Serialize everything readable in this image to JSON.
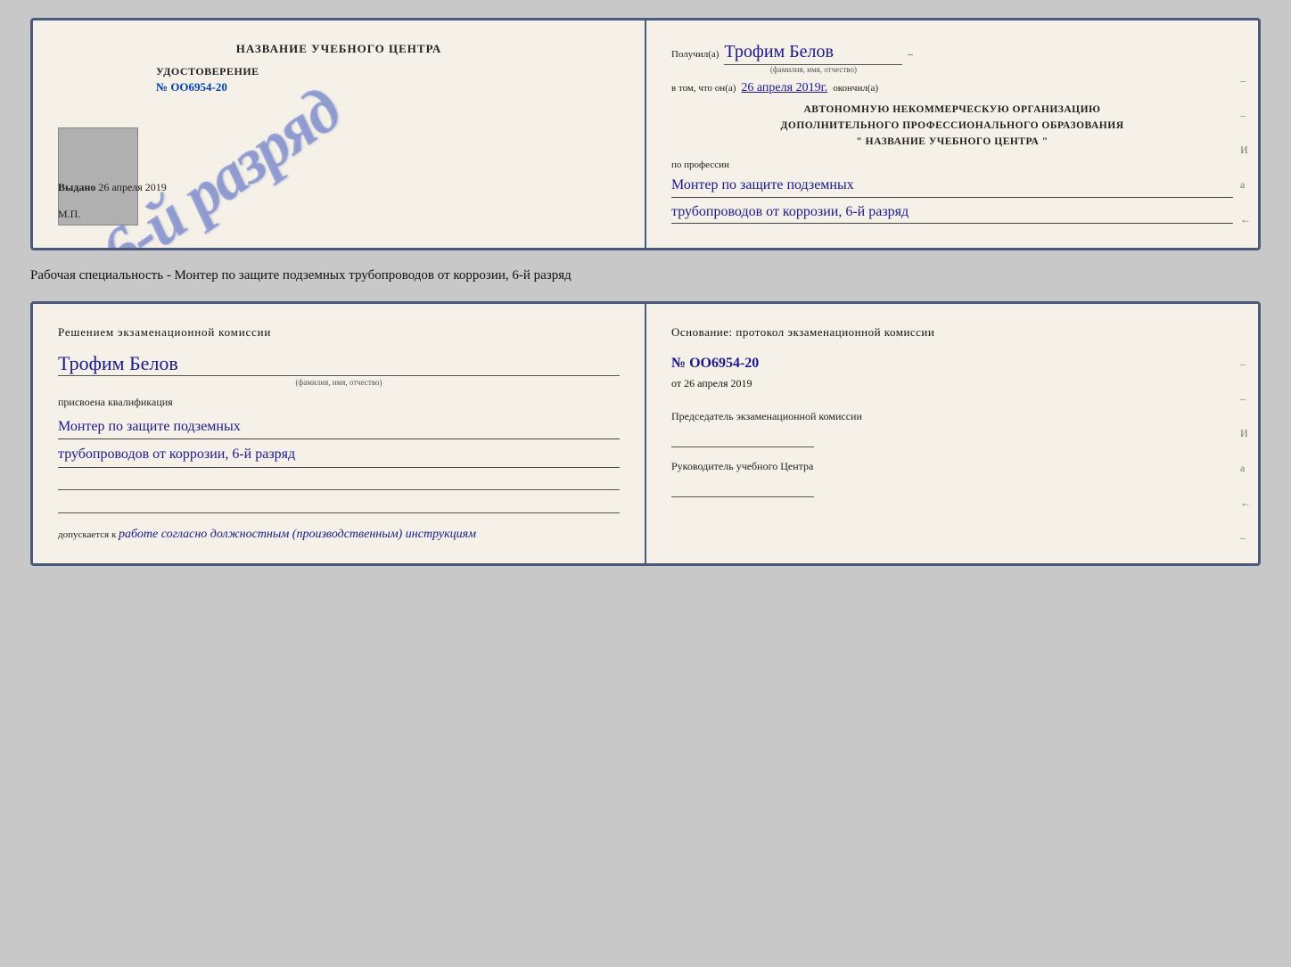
{
  "page": {
    "bg_color": "#c8c8c8"
  },
  "doc1": {
    "left": {
      "header": "НАЗВАНИЕ УЧЕБНОГО ЦЕНТРА",
      "stamp_text": "6-й разряд",
      "udostoverenie_title": "УДОСТОВЕРЕНИЕ",
      "udostoverenie_number": "№ OO6954-20",
      "vydano_label": "Выдано",
      "vydano_date": "26 апреля 2019",
      "mp_label": "М.П."
    },
    "right": {
      "poluchil_label": "Получил(а)",
      "recipient_name": "Трофим Белов",
      "fio_subtitle": "(фамилия, имя, отчество)",
      "dash1": "–",
      "vtom_label": "в том, что он(а)",
      "date_handwritten": "26 апреля 2019г.",
      "okonchil_label": "окончил(а)",
      "org_line1": "АВТОНОМНУЮ НЕКОММЕРЧЕСКУЮ ОРГАНИЗАЦИЮ",
      "org_line2": "ДОПОЛНИТЕЛЬНОГО ПРОФЕССИОНАЛЬНОГО ОБРАЗОВАНИЯ",
      "org_line3": "\"  НАЗВАНИЕ УЧЕБНОГО ЦЕНТРА  \"",
      "po_professii": "по профессии",
      "profession_line1": "Монтер по защите подземных",
      "profession_line2": "трубопроводов от коррозии, 6-й разряд",
      "side_dashes": [
        "-",
        "-",
        "И",
        "а",
        "←",
        "-",
        "-",
        "-"
      ]
    }
  },
  "specialty_text": "Рабочая специальность - Монтер по защите подземных трубопроводов от коррозии, 6-й разряд",
  "doc2": {
    "left": {
      "komissia_title": "Решением  экзаменационной  комиссии",
      "fio_name": "Трофим Белов",
      "fio_subtitle": "(фамилия, имя, отчество)",
      "prisvoena_label": "присвоена квалификация",
      "qualification_line1": "Монтер по защите подземных",
      "qualification_line2": "трубопроводов от коррозии, 6-й разряд",
      "dopuskaetsya_label": "допускается к",
      "dopuskaetsya_value": "работе согласно должностным (производственным) инструкциям"
    },
    "right": {
      "osnovanie_title": "Основание:  протокол  экзаменационной  комиссии",
      "protocol_number": "№  OO6954-20",
      "ot_label": "от",
      "ot_date": "26 апреля 2019",
      "dash1": "–",
      "predsedatel_title": "Председатель экзаменационной комиссии",
      "rukovoditel_title": "Руководитель учебного Центра",
      "side_values": [
        "-",
        "-",
        "–",
        "И",
        "а",
        "←",
        "-",
        "-",
        "-"
      ]
    }
  }
}
